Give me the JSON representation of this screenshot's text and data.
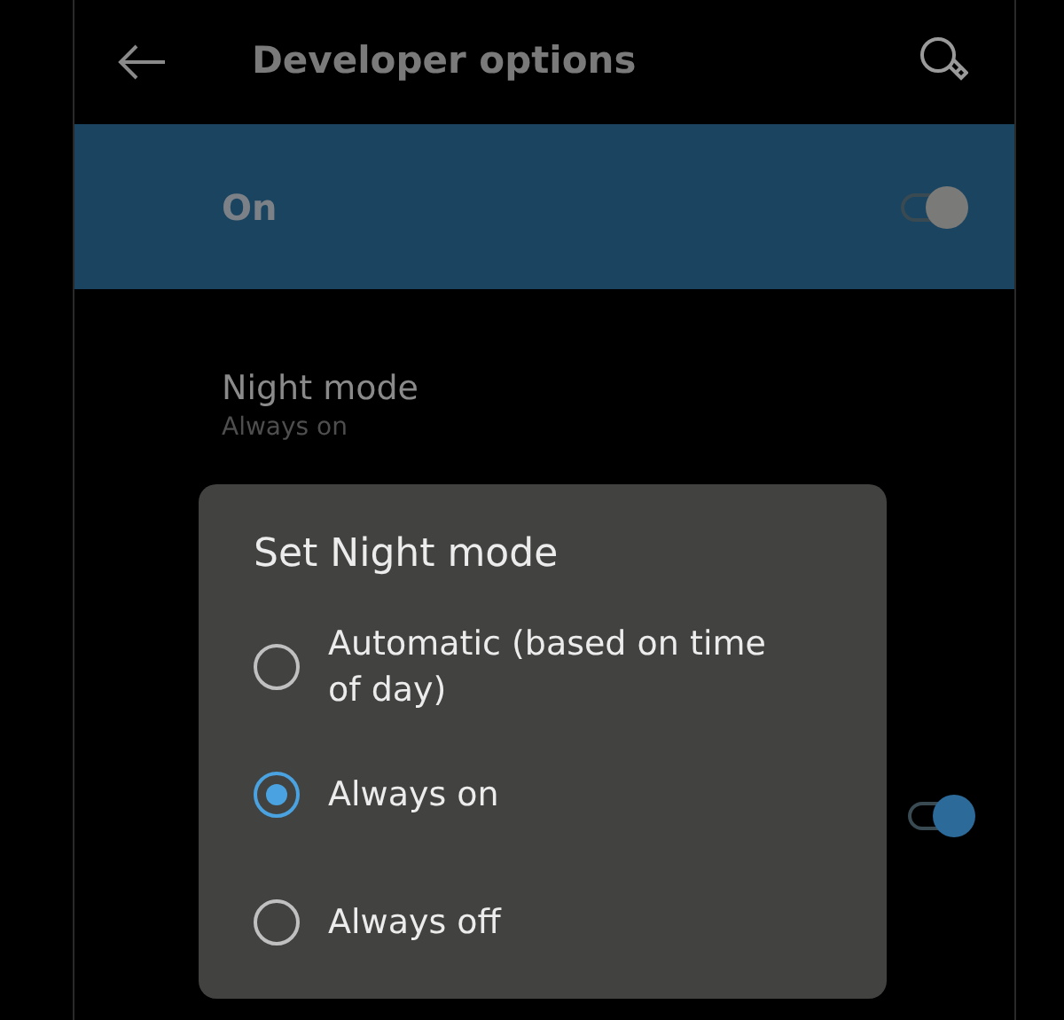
{
  "app_bar": {
    "title": "Developer options"
  },
  "main_switch": {
    "label": "On",
    "on": true
  },
  "settings": [
    {
      "kind": "value",
      "title": "Night mode",
      "summary": "Always on"
    },
    {
      "kind": "switch",
      "on": true
    }
  ],
  "dialog": {
    "title": "Set Night mode",
    "options": [
      {
        "label": "Automatic (based on time of day)",
        "selected": false
      },
      {
        "label": "Always on",
        "selected": true
      },
      {
        "label": "Always off",
        "selected": false
      }
    ]
  }
}
